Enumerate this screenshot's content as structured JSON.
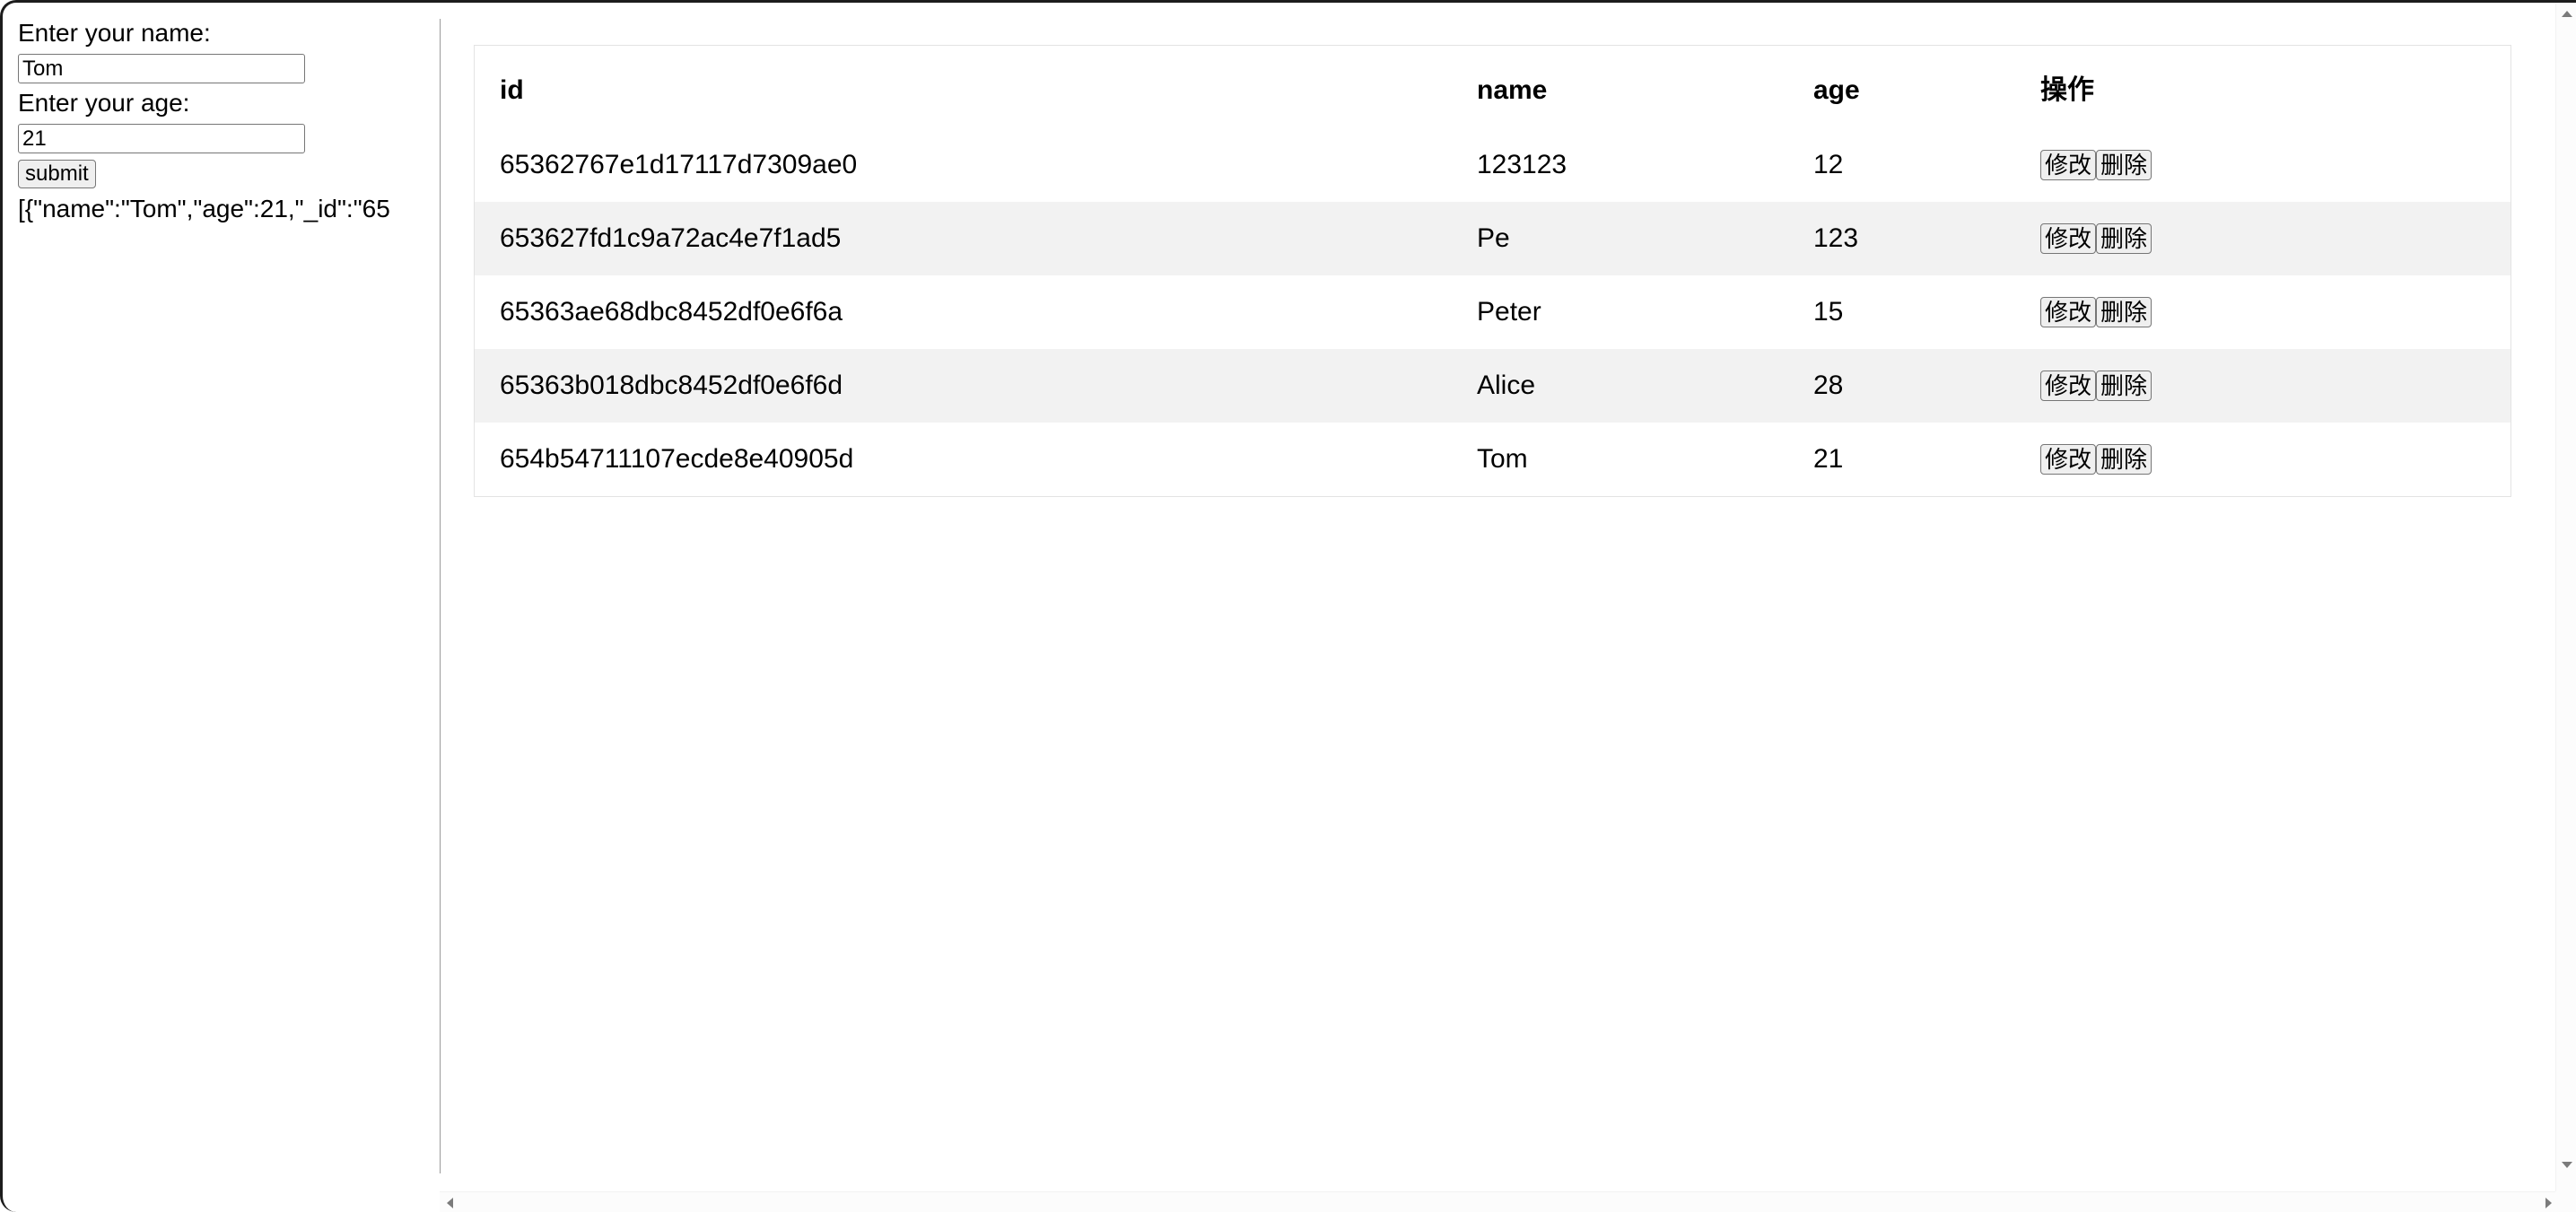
{
  "form": {
    "name_label": "Enter your name:",
    "name_value": "Tom",
    "name_placeholder": "",
    "age_label": "Enter your age:",
    "age_value": "21",
    "age_placeholder": "",
    "submit_label": "submit",
    "result_json": "[{\"name\":\"Tom\",\"age\":21,\"_id\":\"65"
  },
  "table": {
    "columns": [
      {
        "key": "id",
        "label": "id"
      },
      {
        "key": "name",
        "label": "name"
      },
      {
        "key": "age",
        "label": "age"
      },
      {
        "key": "action",
        "label": "操作"
      }
    ],
    "actions": {
      "edit_label": "修改",
      "delete_label": "删除"
    },
    "rows": [
      {
        "id": "65362767e1d17117d7309ae0",
        "name": "123123",
        "age": "12"
      },
      {
        "id": "653627fd1c9a72ac4e7f1ad5",
        "name": "Pe",
        "age": "123"
      },
      {
        "id": "65363ae68dbc8452df0e6f6a",
        "name": "Peter",
        "age": "15"
      },
      {
        "id": "65363b018dbc8452df0e6f6d",
        "name": "Alice",
        "age": "28"
      },
      {
        "id": "654b54711107ecde8e40905d",
        "name": "Tom",
        "age": "21"
      }
    ]
  },
  "scrollbars": {
    "vertical_up_icon": "scroll-up-arrow-icon",
    "vertical_down_icon": "scroll-down-arrow-icon",
    "horizontal_left_icon": "scroll-left-arrow-icon",
    "horizontal_right_icon": "scroll-right-arrow-icon"
  },
  "colors": {
    "page_background": "#ffffff",
    "stripe_row": "#f2f2f2",
    "card_border": "#e3e3e3",
    "divider": "#9a9a9a",
    "button_face": "#efefef",
    "button_border": "#767676",
    "text": "#000000"
  }
}
